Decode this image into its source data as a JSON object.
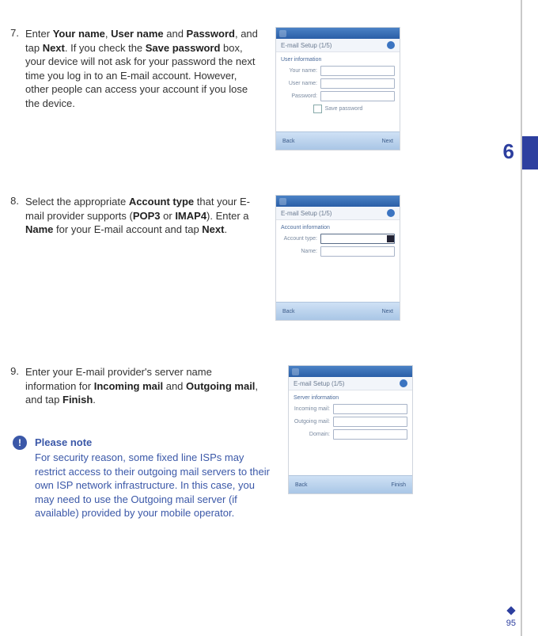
{
  "chapter_number": "6",
  "page_number": "95",
  "steps": {
    "s7": {
      "num": "7.",
      "html": "Enter <b>Your name</b>, <b>User name</b> and <b>Password</b>, and tap <b>Next</b>. If you check the <b>Save password</b> box, your device will not ask for your password the next time you log in to an E-mail account. However, other people can access your account if you lose the device."
    },
    "s8": {
      "num": "8.",
      "html": "Select the appropriate <b>Account type</b> that your E-mail provider supports (<b>POP3</b> or <b>IMAP4</b>). Enter a <b>Name</b> for your E-mail account and tap <b>Next</b>."
    },
    "s9": {
      "num": "9.",
      "html": "Enter your E-mail provider's server name information for <b>Incoming mail</b> and <b>Outgoing mail</b>, and tap <b>Finish</b>."
    }
  },
  "note": {
    "title": "Please note",
    "body": "For security reason, some fixed line ISPs may restrict access to their outgoing mail servers to their own ISP network infrastructure. In this case, you may need to use the Outgoing mail server (if available) provided by your mobile operator."
  },
  "shots": {
    "common_sub": "E-mail Setup (1/5)",
    "s7": {
      "section": "User information",
      "f1": "Your name:",
      "f2": "User name:",
      "f3": "Password:",
      "check": "Save password",
      "btn_l": "Back",
      "btn_r": "Next"
    },
    "s8": {
      "section": "Account information",
      "f1": "Account type:",
      "f2": "Name:",
      "btn_l": "Back",
      "btn_r": "Next"
    },
    "s9": {
      "section": "Server information",
      "f1": "Incoming mail:",
      "f2": "Outgoing mail:",
      "f3": "Domain:",
      "btn_l": "Back",
      "btn_r": "Finish"
    }
  }
}
